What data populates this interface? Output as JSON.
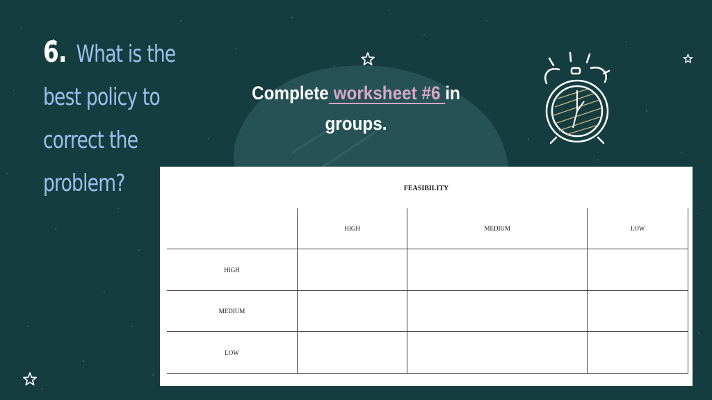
{
  "slide": {
    "number": "6.",
    "title_lines": [
      "What is the",
      "best policy to",
      "correct the",
      "problem?"
    ],
    "subtitle": {
      "before": "Complete",
      "link": " worksheet #6 ",
      "after": "in",
      "line2": "groups."
    }
  },
  "worksheet": {
    "title": "FEASIBILITY",
    "column_headers": [
      "HIGH",
      "MEDIUM",
      "LOW"
    ],
    "row_headers": [
      "HIGH",
      "MEDIUM",
      "LOW"
    ]
  },
  "colors": {
    "background": "#153d40",
    "title_blue": "#9cc0ec",
    "link_pink": "#d7a6c6"
  },
  "icons": [
    "star-icon",
    "alarm-clock-icon"
  ]
}
